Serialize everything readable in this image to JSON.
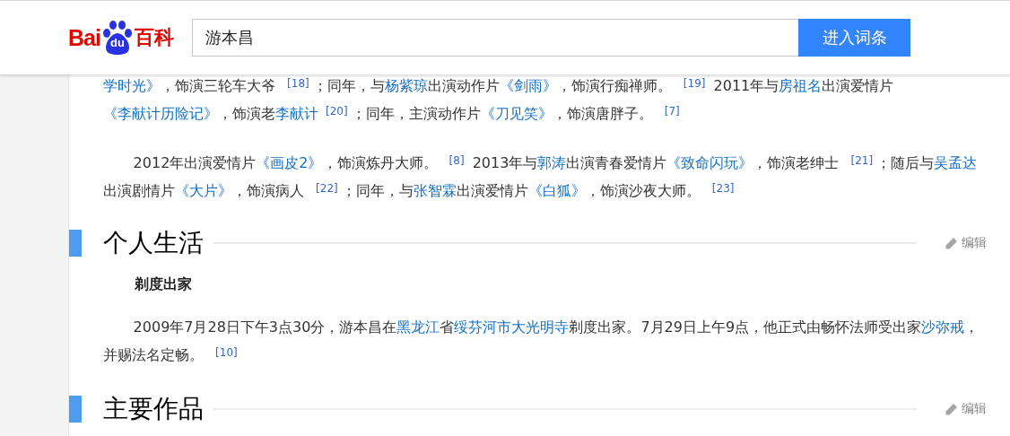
{
  "header": {
    "logo": {
      "left": "Bai",
      "mark": "du",
      "right": "百科"
    },
    "search": {
      "value": "游本昌"
    },
    "button": "进入词条"
  },
  "blocks": [
    {
      "kind": "paragraph",
      "continued": true,
      "segments": [
        {
          "kind": "link",
          "text": "学时光》"
        },
        {
          "kind": "text",
          "text": "，饰演三轮车大爷 "
        },
        {
          "kind": "ref",
          "text": "[18]"
        },
        {
          "kind": "text",
          "text": "；同年，与"
        },
        {
          "kind": "link",
          "text": "杨紫琼"
        },
        {
          "kind": "text",
          "text": "出演动作片"
        },
        {
          "kind": "link",
          "text": "《剑雨》"
        },
        {
          "kind": "text",
          "text": "，饰演行痴禅师。 "
        },
        {
          "kind": "ref",
          "text": "[19]"
        },
        {
          "kind": "text",
          "text": " 2011年与"
        },
        {
          "kind": "link",
          "text": "房祖名"
        },
        {
          "kind": "text",
          "text": "出演爱情片"
        },
        {
          "kind": "link",
          "text": "《李献计历险记》"
        },
        {
          "kind": "text",
          "text": "，饰演老"
        },
        {
          "kind": "link",
          "text": "李献计"
        },
        {
          "kind": "ref",
          "text": "[20]"
        },
        {
          "kind": "text",
          "text": "；同年，主演动作片"
        },
        {
          "kind": "link",
          "text": "《刀见笑》"
        },
        {
          "kind": "text",
          "text": "，饰演唐胖子。 "
        },
        {
          "kind": "ref",
          "text": "[7]"
        }
      ]
    },
    {
      "kind": "paragraph",
      "continued": false,
      "segments": [
        {
          "kind": "text",
          "text": "2012年出演爱情片"
        },
        {
          "kind": "link",
          "text": "《画皮2》"
        },
        {
          "kind": "text",
          "text": "，饰演炼丹大师。 "
        },
        {
          "kind": "ref",
          "text": "[8]"
        },
        {
          "kind": "text",
          "text": " 2013年与"
        },
        {
          "kind": "link",
          "text": "郭涛"
        },
        {
          "kind": "text",
          "text": "出演青春爱情片"
        },
        {
          "kind": "link",
          "text": "《致命闪玩》"
        },
        {
          "kind": "text",
          "text": "，饰演老绅士 "
        },
        {
          "kind": "ref",
          "text": "[21]"
        },
        {
          "kind": "text",
          "text": "；随后与"
        },
        {
          "kind": "link",
          "text": "吴孟达"
        },
        {
          "kind": "text",
          "text": "出演剧情片"
        },
        {
          "kind": "link",
          "text": "《大片》"
        },
        {
          "kind": "text",
          "text": "，饰演病人 "
        },
        {
          "kind": "ref",
          "text": "[22]"
        },
        {
          "kind": "text",
          "text": "；同年，与"
        },
        {
          "kind": "link",
          "text": "张智霖"
        },
        {
          "kind": "text",
          "text": "出演爱情片"
        },
        {
          "kind": "link",
          "text": "《白狐》"
        },
        {
          "kind": "text",
          "text": "，饰演沙夜大师。 "
        },
        {
          "kind": "ref",
          "text": "[23]"
        }
      ]
    },
    {
      "kind": "heading",
      "title": "个人生活",
      "edit": "编辑"
    },
    {
      "kind": "subheading",
      "title": "剃度出家"
    },
    {
      "kind": "paragraph",
      "continued": false,
      "segments": [
        {
          "kind": "text",
          "text": "2009年7月28日下午3点30分，游本昌在"
        },
        {
          "kind": "link",
          "text": "黑龙江"
        },
        {
          "kind": "text",
          "text": "省"
        },
        {
          "kind": "link",
          "text": "绥芬河市大光明寺"
        },
        {
          "kind": "text",
          "text": "剃度出家。7月29日上午9点，他正式由畅怀法师受出家"
        },
        {
          "kind": "link",
          "text": "沙弥戒"
        },
        {
          "kind": "text",
          "text": "，并赐法名定畅。 "
        },
        {
          "kind": "ref",
          "text": "[10]"
        }
      ]
    },
    {
      "kind": "heading",
      "title": "主要作品",
      "edit": "编辑"
    }
  ]
}
